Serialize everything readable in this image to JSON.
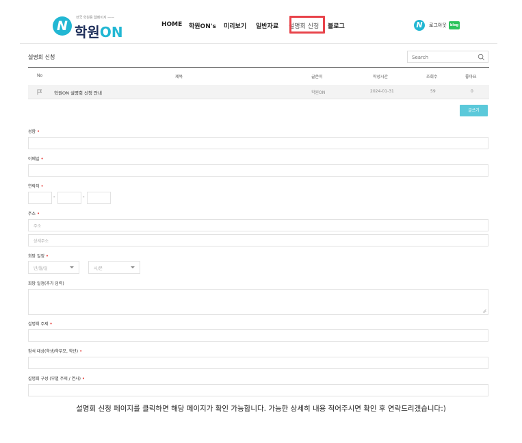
{
  "header": {
    "logo_tagline": "전국 학원용 웹페이지 ——",
    "logo_name_main": "학원",
    "logo_name_accent": "ON",
    "nav": [
      "HOME",
      "학원ON's",
      "미리보기",
      "일반자료",
      "설명회 신청",
      "블로그"
    ],
    "logout": "로그아웃",
    "blog_badge": "blog",
    "highlight_color": "#e8434a",
    "brand_color": "#22b7d3"
  },
  "board": {
    "title": "설명회 신청",
    "search_placeholder": "Search",
    "columns": [
      "No",
      "제목",
      "글쓴이",
      "작성시간",
      "조회수",
      "좋아요"
    ],
    "rows": [
      {
        "title": "학원ON 설명회 신청 안내",
        "author": "학원ON",
        "date": "2024-01-31",
        "views": "59",
        "likes": "0",
        "icon": "flag-icon"
      }
    ],
    "write_button": "글쓰기"
  },
  "form": {
    "name_label": "성함",
    "email_label": "이메일",
    "phone_label": "연락처",
    "address_label": "주소",
    "address_placeholder": "주소",
    "address_detail_placeholder": "상세주소",
    "schedule_label": "희망 일정",
    "date_placeholder": "년/월/일",
    "time_placeholder": "시/분",
    "extra_schedule_label": "희망 일정(추가 입력)",
    "topic_label": "설명회 주제",
    "audience_label": "참석 대상(학생/학부모, 학년)",
    "composition_label": "설명회 구성 (부별 주제 / 연사)",
    "required_mark": "•"
  },
  "caption": "설명회 신청 페이지를 클릭하면 해당 페이지가 확인 가능합니다. 가능한 상세히 내용 적어주시면 확인 후 연락드리겠습니다:)"
}
